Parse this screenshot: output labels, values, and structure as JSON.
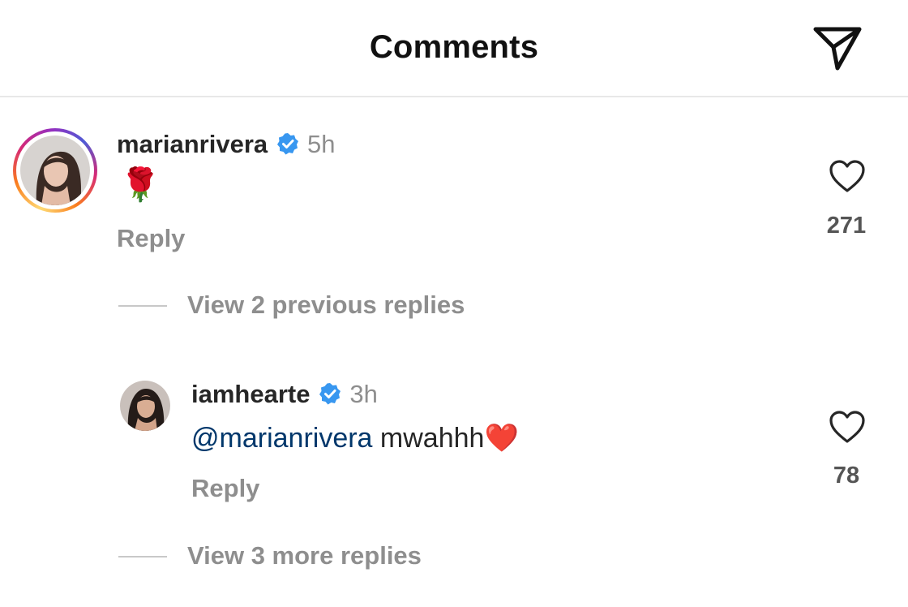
{
  "header": {
    "title": "Comments",
    "share_icon": "paper-plane-icon"
  },
  "comments": [
    {
      "username": "marianrivera",
      "verified": true,
      "timestamp": "5h",
      "text": "🌹",
      "reply_label": "Reply",
      "likes": "271",
      "avatar_story_ring": true
    }
  ],
  "replies_previous": {
    "label": "View 2 previous replies"
  },
  "replies": [
    {
      "username": "iamhearte",
      "verified": true,
      "timestamp": "3h",
      "mention": "@marianrivera",
      "text": "mwahhh",
      "emoji": "❤️",
      "reply_label": "Reply",
      "likes": "78"
    }
  ],
  "replies_more": {
    "label": "View 3 more replies"
  },
  "colors": {
    "mention": "#00376b",
    "verified": "#3897f0",
    "muted": "#8e8e8e"
  }
}
